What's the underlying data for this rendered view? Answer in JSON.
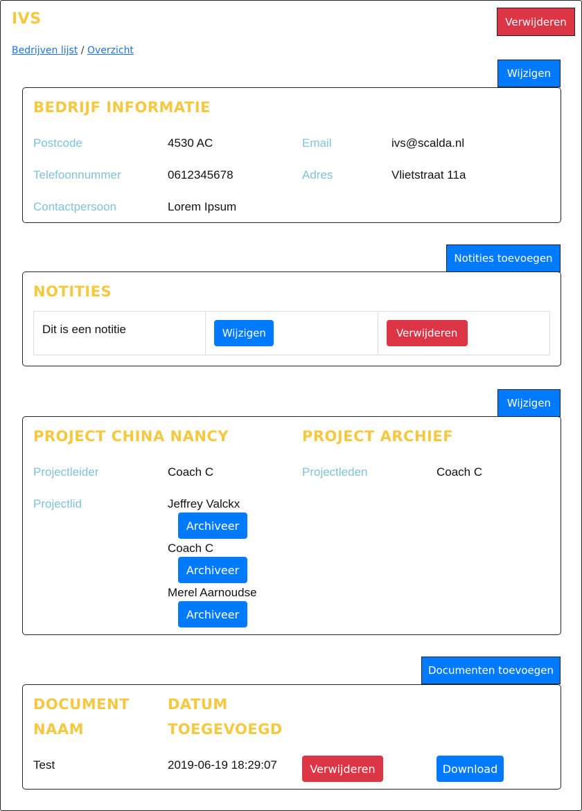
{
  "header": {
    "title": "IVS",
    "delete_label": "Verwijderen"
  },
  "breadcrumb": {
    "list_label": "Bedrijven lijst",
    "separator": "/",
    "current_label": "Overzicht"
  },
  "company": {
    "edit_label": "Wijzigen",
    "title": "BEDRIJF INFORMATIE",
    "fields": [
      {
        "label": "Postcode",
        "value": "4530 AC"
      },
      {
        "label": "Email",
        "value": "ivs@scalda.nl"
      },
      {
        "label": "Telefoonnummer",
        "value": "0612345678"
      },
      {
        "label": "Adres",
        "value": "Vlietstraat 11a"
      },
      {
        "label": "Contactpersoon",
        "value": "Lorem Ipsum"
      }
    ]
  },
  "notes": {
    "add_label": "Notities toevoegen",
    "title": "NOTITIES",
    "items": [
      {
        "text": "Dit is een notitie",
        "edit_label": "Wijzigen",
        "delete_label": "Verwijderen"
      }
    ]
  },
  "project": {
    "edit_label": "Wijzigen",
    "title": "PROJECT CHINA NANCY",
    "archive_title": "PROJECT ARCHIEF",
    "leader_label": "Projectleider",
    "leader_value": "Coach C",
    "members_label": "Projectleden",
    "members_value": "Coach C",
    "member_label": "Projectlid",
    "members": [
      {
        "name": "Jeffrey Valckx",
        "archive_label": "Archiveer"
      },
      {
        "name": "Coach C",
        "archive_label": "Archiveer"
      },
      {
        "name": "Merel Aarnoudse",
        "archive_label": "Archiveer"
      }
    ]
  },
  "documents": {
    "add_label": "Documenten toevoegen",
    "col_name_line1": "DOCUMENT",
    "col_name_line2": "NAAM",
    "col_date_line1": "DATUM",
    "col_date_line2": "TOEGEVOEGD",
    "rows": [
      {
        "name": "Test",
        "date": "2019-06-19 18:29:07",
        "delete_label": "Verwijderen",
        "download_label": "Download"
      }
    ]
  },
  "colors": {
    "accent_yellow": "#f5c842",
    "label_blue": "#7ec3d8",
    "primary": "#007bff",
    "danger": "#dc3545",
    "link": "#1a73e8"
  }
}
